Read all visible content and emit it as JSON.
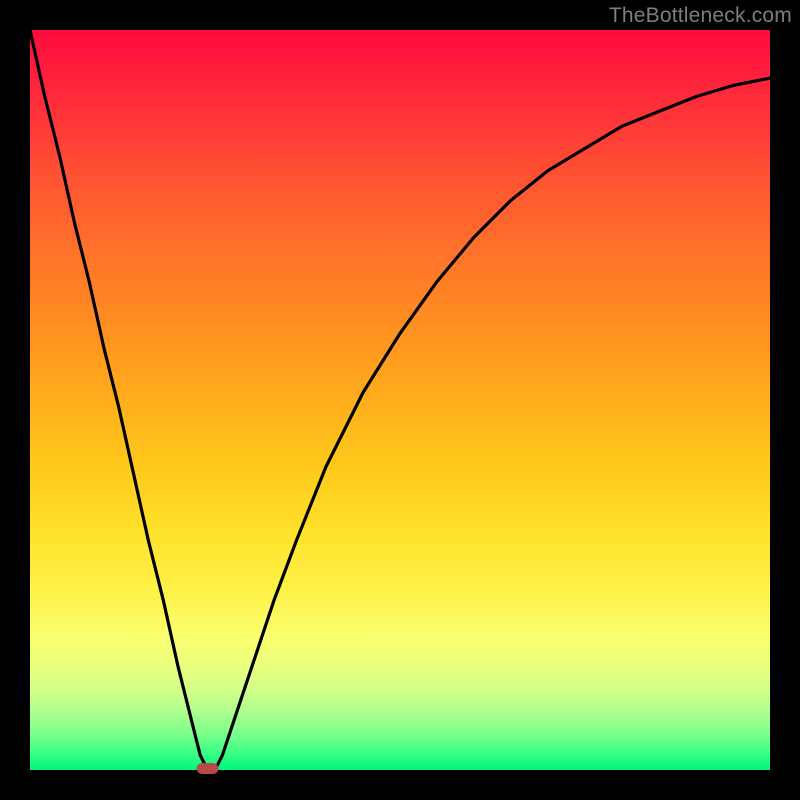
{
  "watermark": "TheBottleneck.com",
  "chart_data": {
    "type": "line",
    "title": "",
    "xlabel": "",
    "ylabel": "",
    "xlim": [
      0,
      100
    ],
    "ylim": [
      0,
      100
    ],
    "grid": false,
    "background_gradient": [
      "#ff0a3e",
      "#00f57c"
    ],
    "series": [
      {
        "name": "curve",
        "x": [
          0,
          2,
          4,
          6,
          8,
          10,
          12,
          14,
          16,
          18,
          20,
          22,
          23,
          24,
          25,
          26,
          28,
          30,
          33,
          36,
          40,
          45,
          50,
          55,
          60,
          65,
          70,
          75,
          80,
          85,
          90,
          95,
          100
        ],
        "y": [
          100,
          91,
          83,
          74,
          66,
          57,
          49,
          40,
          31,
          23,
          14,
          6,
          2,
          0,
          0,
          2,
          8,
          14,
          23,
          31,
          41,
          51,
          59,
          66,
          72,
          77,
          81,
          84,
          87,
          89,
          91,
          92.5,
          93.5
        ]
      }
    ],
    "marker": {
      "x": 24,
      "y": 0,
      "color": "#b64a4a"
    }
  }
}
